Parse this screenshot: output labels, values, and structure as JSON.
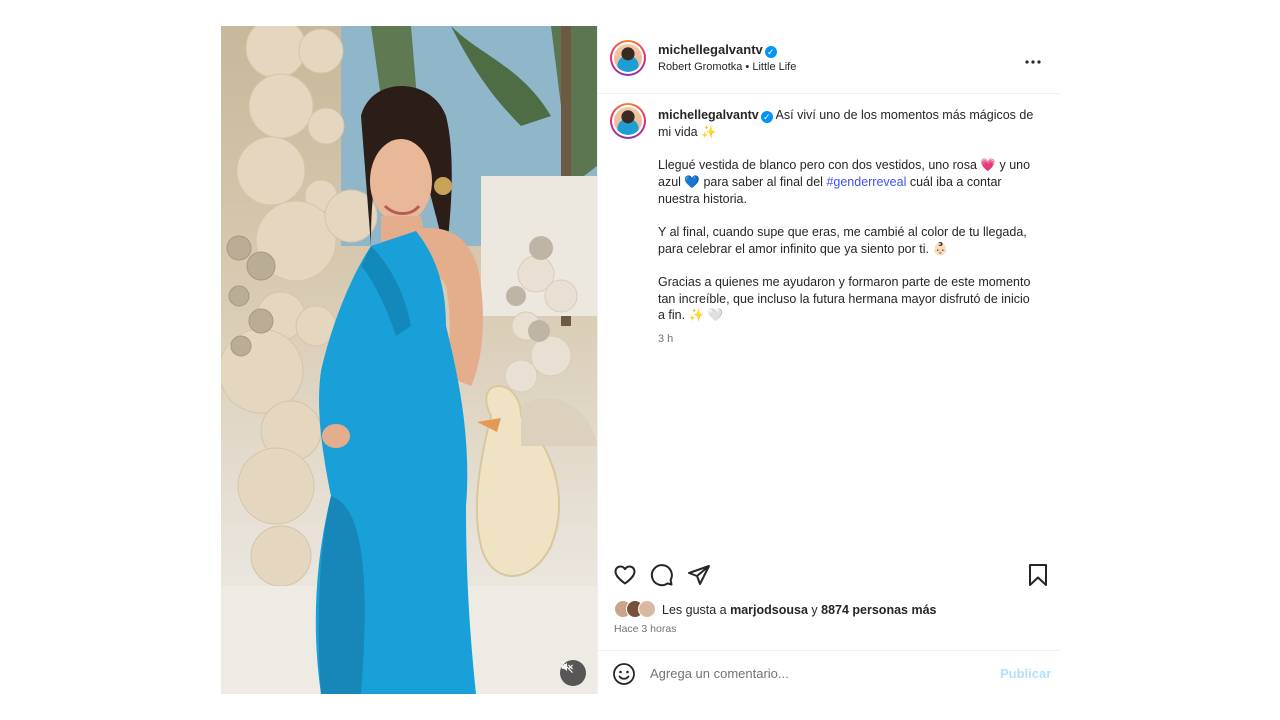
{
  "post": {
    "username": "michellegalvantv",
    "verified": true,
    "audio": "Robert Gromotka • Little Life",
    "more_label": "•••"
  },
  "caption": {
    "line1": "Así viví uno de los momentos más mágicos de mi vida ✨",
    "p2_before": "Llegué vestida de blanco pero con dos vestidos, uno rosa 💗  y uno azul 💙  para saber al final del ",
    "hashtag": "#genderreveal",
    "p2_after": " cuál iba a contar nuestra historia.",
    "p3": "Y al final, cuando supe que eras, me cambié al color de tu llegada, para celebrar el amor infinito que ya siento por ti. 👶🏻",
    "p4": "Gracias a quienes me ayudaron y formaron parte de este momento tan increíble, que incluso la futura hermana mayor disfrutó de inicio a fin. ✨ 🤍",
    "time": "3 h"
  },
  "actions": {
    "like_icon": "heart-icon",
    "comment_icon": "comment-icon",
    "share_icon": "share-icon",
    "save_icon": "bookmark-icon"
  },
  "likes": {
    "prefix": "Les gusta a ",
    "user": "marjodsousa",
    "middle": " y ",
    "count": "8874 personas más"
  },
  "posted_ago": "Hace 3 horas",
  "comment": {
    "placeholder": "Agrega un comentario...",
    "publish_label": "Publicar"
  },
  "media": {
    "mute_icon": "speaker-muted-icon",
    "description_colors": {
      "dress": "#1aa0d8",
      "balloons": "#e8ddcb"
    }
  }
}
